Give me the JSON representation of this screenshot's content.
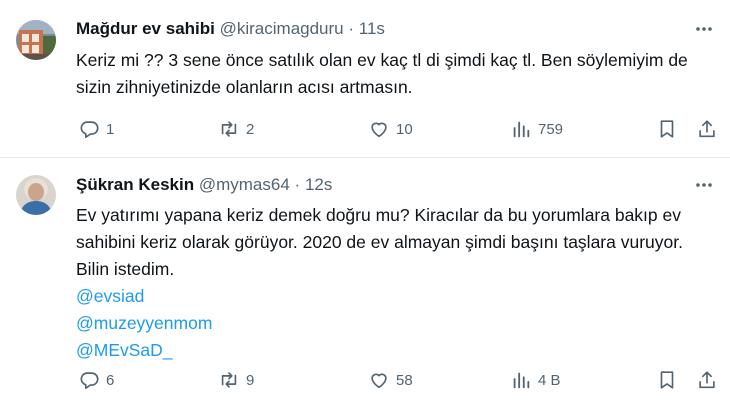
{
  "tweets": [
    {
      "name": "Mağdur ev sahibi",
      "handle": "@kiracimagduru",
      "separator": "·",
      "time": "11s",
      "text": "Keriz mi ?? 3 sene önce satılık olan ev kaç tl di şimdi kaç tl. Ben söylemiyim de sizin zihniyetinizde olanların acısı artmasın.",
      "mentions": [],
      "replies": "1",
      "retweets": "2",
      "likes": "10",
      "views": "759"
    },
    {
      "name": "Şükran Keskin",
      "handle": "@mymas64",
      "separator": "·",
      "time": "12s",
      "text": "Ev yatırımı yapana keriz demek doğru mu?  Kiracılar da bu yorumlara bakıp ev sahibini keriz olarak görüyor. 2020 de ev almayan şimdi başını taşlara vuruyor. Bilin istedim.",
      "mentions": [
        "@evsiad",
        "@muzeyyenmom",
        "@MEvSaD_"
      ],
      "replies": "6",
      "retweets": "9",
      "likes": "58",
      "views": "4 B"
    }
  ],
  "icons": {
    "more": "more-horizontal-icon",
    "reply": "reply-icon",
    "retweet": "retweet-icon",
    "like": "heart-icon",
    "views": "views-icon",
    "bookmark": "bookmark-icon",
    "share": "share-icon"
  },
  "colors": {
    "text": "#0f1419",
    "secondary": "#536471",
    "link": "#1d9bf0",
    "divider": "#e6e9ea"
  }
}
